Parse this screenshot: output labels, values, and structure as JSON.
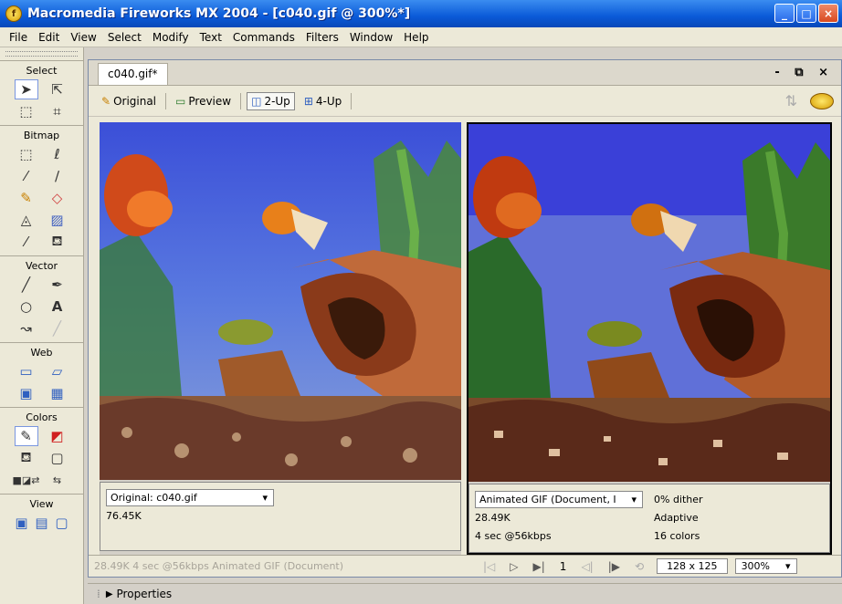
{
  "window": {
    "title": "Macromedia Fireworks MX 2004 - [c040.gif @ 300%*]",
    "minimize": "_",
    "maximize": "□",
    "close": "×"
  },
  "menu": [
    {
      "label": "File"
    },
    {
      "label": "Edit"
    },
    {
      "label": "View"
    },
    {
      "label": "Select"
    },
    {
      "label": "Modify"
    },
    {
      "label": "Text"
    },
    {
      "label": "Commands"
    },
    {
      "label": "Filters"
    },
    {
      "label": "Window"
    },
    {
      "label": "Help"
    }
  ],
  "tools": {
    "select_label": "Select",
    "bitmap_label": "Bitmap",
    "vector_label": "Vector",
    "web_label": "Web",
    "colors_label": "Colors",
    "view_label": "View"
  },
  "document": {
    "tab": "c040.gif*",
    "views": {
      "original": "Original",
      "preview": "Preview",
      "two_up": "2-Up",
      "four_up": "4-Up"
    }
  },
  "left_pane": {
    "format": "Original: c040.gif",
    "size": "76.45K"
  },
  "right_pane": {
    "format": "Animated GIF (Document, I",
    "size": "28.49K",
    "time": "4 sec @56kbps",
    "dither": "0% dither",
    "palette": "Adaptive",
    "colors": "16 colors"
  },
  "status": {
    "text": "28.49K  4 sec @56kbps  Animated GIF (Document)",
    "frame": "1",
    "dimensions": "128 x 125",
    "zoom": "300%"
  },
  "properties": {
    "label": "Properties"
  }
}
